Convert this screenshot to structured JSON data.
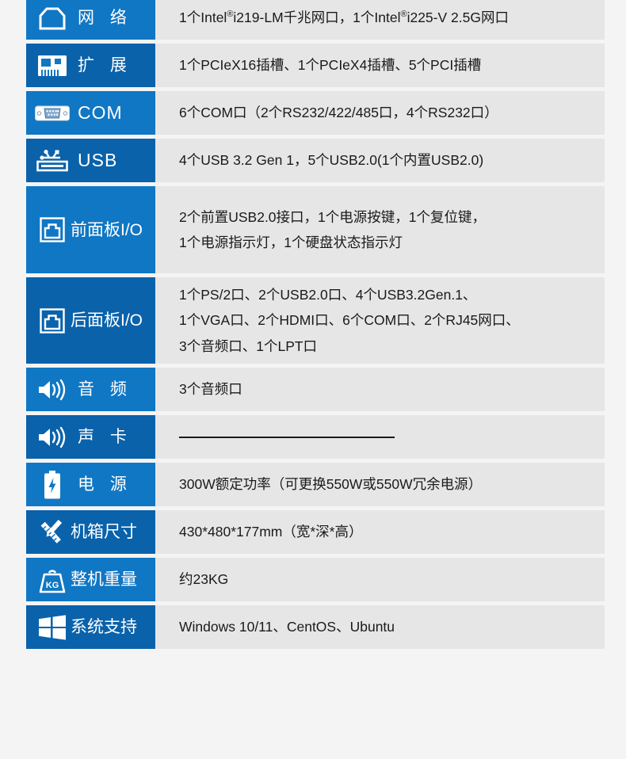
{
  "theme": {
    "page_background": "#f4f4f4",
    "value_background": "#e6e6e6",
    "label_blue_light": "#1077c4",
    "label_blue_dark": "#0a62ab",
    "text_color": "#1a1a1a",
    "label_text_color": "#ffffff"
  },
  "spec_table": {
    "rows": [
      {
        "icon": "rj45-network-port-icon",
        "label": "网 络",
        "value_lines": [
          "1个Intel®i219-LM千兆网口，1个Intel®i225-V 2.5G网口"
        ]
      },
      {
        "icon": "expansion-card-icon",
        "label": "扩 展",
        "value_lines": [
          "1个PCIeX16插槽、1个PCIeX4插槽、5个PCI插槽"
        ]
      },
      {
        "icon": "db9-serial-port-icon",
        "label": "COM",
        "value_lines": [
          "6个COM口（2个RS232/422/485口，4个RS232口）"
        ]
      },
      {
        "icon": "usb-port-icon",
        "label": "USB",
        "value_lines": [
          "4个USB 3.2 Gen 1，5个USB2.0(1个内置USB2.0)"
        ]
      },
      {
        "icon": "front-panel-io-icon",
        "label": "前面板I/O",
        "value_lines": [
          "2个前置USB2.0接口，1个电源按键，1个复位键，",
          "1个电源指示灯，1个硬盘状态指示灯"
        ]
      },
      {
        "icon": "rear-panel-io-icon",
        "label": "后面板I/O",
        "value_lines": [
          "1个PS/2口、2个USB2.0口、4个USB3.2Gen.1、",
          "1个VGA口、2个HDMI口、6个COM口、2个RJ45网口、",
          "3个音频口、1个LPT口"
        ]
      },
      {
        "icon": "speaker-audio-icon",
        "label": "音 频",
        "value_lines": [
          "3个音频口"
        ]
      },
      {
        "icon": "speaker-audio-icon",
        "label": "声 卡",
        "value_lines": [],
        "value_is_dash": true
      },
      {
        "icon": "battery-power-icon",
        "label": "电 源",
        "value_lines": [
          "300W额定功率（可更换550W或550W冗余电源）"
        ]
      },
      {
        "icon": "ruler-pencil-dimensions-icon",
        "label": "机箱尺寸",
        "value_lines": [
          "430*480*177mm（宽*深*高）"
        ]
      },
      {
        "icon": "weight-kg-icon",
        "label": "整机重量",
        "value_lines": [
          "约23KG"
        ]
      },
      {
        "icon": "windows-logo-icon",
        "label": "系统支持",
        "value_lines": [
          "Windows 10/11、CentOS、Ubuntu"
        ]
      }
    ]
  }
}
